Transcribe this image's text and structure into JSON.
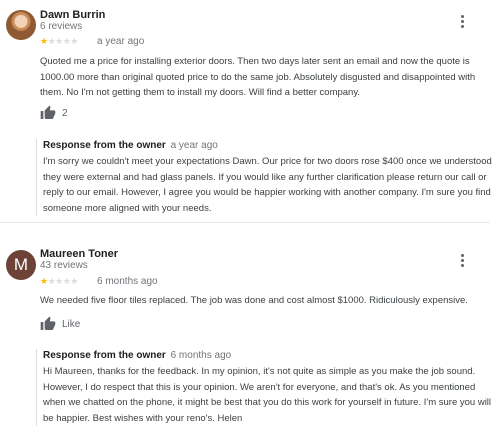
{
  "reviews": [
    {
      "name": "Dawn Burrin",
      "count": "6 reviews",
      "rating": 1,
      "age": "a year ago",
      "text": "Quoted me a price for installing exterior doors. Then two days later sent an email and now the quote is 1000.00 more than original quoted price to do the same job. Absolutely disgusted and disappointed with them. No I'm not getting them to install my doors. Will find a better company.",
      "likes": "2",
      "avatar_type": "photo",
      "reply": {
        "title": "Response from the owner",
        "age": "a year ago",
        "text": "I'm sorry we couldn't meet your expectations Dawn. Our price for two doors rose $400 once we understood they were external and had glass panels. If you would like any further clarification please return our call or reply to our email. However, I agree you would be happier working with another company. I'm sure you find someone more aligned with your needs."
      }
    },
    {
      "name": "Maureen Toner",
      "count": "43 reviews",
      "rating": 1,
      "age": "6 months ago",
      "text": "We needed five floor tiles replaced. The job was done and cost almost $1000. Ridiculously expensive.",
      "likes": "Like",
      "avatar_letter": "M",
      "avatar_color": "#6d4338",
      "reply": {
        "title": "Response from the owner",
        "age": "6 months ago",
        "text": "Hi Maureen, thanks for the feedback. In my opinion, it's not quite as simple as you make the job sound. However, I do respect that this is your opinion. We aren't for everyone, and that's ok. As you mentioned when we chatted on the phone, it might be best that you do this work for yourself in future. I'm sure you will be happier. Best wishes with your reno's. Helen"
      }
    }
  ],
  "colors": {
    "star_filled": "#fbbc04",
    "star_empty": "#dadce0",
    "icon": "#5f6368"
  },
  "icons": {
    "menu": "more-vert-icon",
    "like": "thumb-up-icon"
  }
}
